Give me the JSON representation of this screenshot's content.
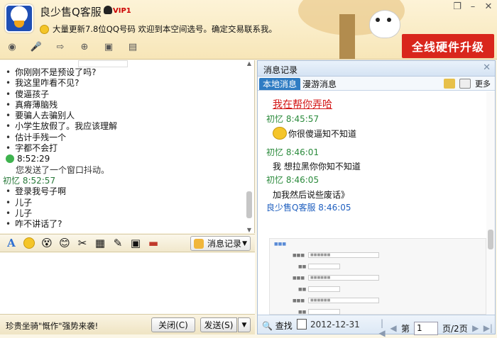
{
  "window": {
    "title": "良少售Q客服",
    "vip_badge": "VIP1",
    "signature": "大量更新7.8位QQ号码  欢迎到本空间选号。确定交易联系我。",
    "banner": "全线硬件升级",
    "controls": [
      "❐",
      "–",
      "✕"
    ]
  },
  "chat": {
    "lines": [
      {
        "type": "bullet",
        "text": "你刚刚不是预设了吗?"
      },
      {
        "type": "bullet",
        "text": "我这里咋看不见?"
      },
      {
        "type": "bullet",
        "text": "傻逼孩子"
      },
      {
        "type": "bullet",
        "text": "真瘠薄脑残"
      },
      {
        "type": "bullet",
        "text": "要骗人去骗别人"
      },
      {
        "type": "bullet",
        "text": "小学生放假了。我应该理解"
      },
      {
        "type": "bullet",
        "text": "估计手残一个"
      },
      {
        "type": "bullet",
        "text": "字都不会打"
      },
      {
        "type": "time",
        "text": "8:52:29"
      },
      {
        "type": "system",
        "text": "您发送了一个窗口抖动。"
      },
      {
        "type": "sender",
        "text": "初忆  8:52:57"
      },
      {
        "type": "bullet",
        "text": "登录我号子啊"
      },
      {
        "type": "bullet",
        "text": "儿子"
      },
      {
        "type": "bullet",
        "text": "儿子"
      },
      {
        "type": "bullet",
        "text": "咋不讲话了?"
      }
    ]
  },
  "input_toolbar": {
    "history_label": "消息记录"
  },
  "bottom": {
    "ad_text": "珍贵坐骑\"慨作\"强势来袭!",
    "close_label": "关闭(C)",
    "send_label": "发送(S)"
  },
  "history": {
    "title": "消息记录",
    "tab_local": "本地消息",
    "tab_roam": "漫游消息",
    "more": "更多",
    "entries": {
      "big_red": "我在帮你弄哈",
      "e1_name": "初忆  8:45:57",
      "e1_text": "你很傻逼知不知道",
      "e2_name": "初忆  8:46:01",
      "e2_text": "我  想拉黑你你知不知道",
      "e3_name": "初忆  8:46:05",
      "e3_text": "加我然后说些废话》",
      "e4_name": "良少售Q客服  8:46:05"
    },
    "footer": {
      "find": "查找",
      "date": "2012-12-31",
      "page_label": "第",
      "page_value": "1",
      "page_total": "页/2页"
    }
  }
}
